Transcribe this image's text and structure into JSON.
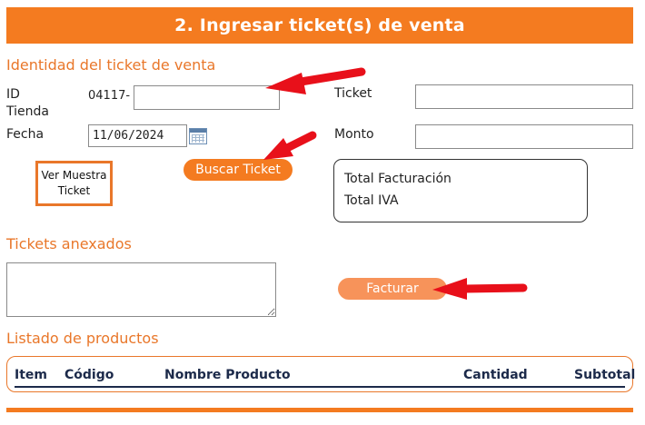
{
  "header": {
    "title": "2. Ingresar ticket(s) de venta"
  },
  "identity": {
    "section_title": "Identidad del ticket de venta",
    "store_id_label_line1": "ID",
    "store_id_label_line2": "Tienda",
    "store_id_prefix": "04117-",
    "store_id_value": "",
    "date_label": "Fecha",
    "date_value": "11/06/2024",
    "ticket_label": "Ticket",
    "ticket_value": "",
    "amount_label": "Monto",
    "amount_value": ""
  },
  "buttons": {
    "sample_line1": "Ver Muestra",
    "sample_line2": "Ticket",
    "search": "Buscar Ticket",
    "invoice": "Facturar"
  },
  "totals": {
    "billing_label": "Total Facturación",
    "tax_label": "Total IVA"
  },
  "annexed": {
    "section_title": "Tickets anexados",
    "value": ""
  },
  "products": {
    "section_title": "Listado de productos",
    "columns": [
      "Item",
      "Código",
      "Nombre Producto",
      "Cantidad",
      "Subtotal"
    ]
  },
  "colors": {
    "accent": "#f47b20",
    "arrow": "#e8101a",
    "table_text": "#1c2a4a"
  },
  "icons": {
    "calendar": "calendar-icon"
  }
}
